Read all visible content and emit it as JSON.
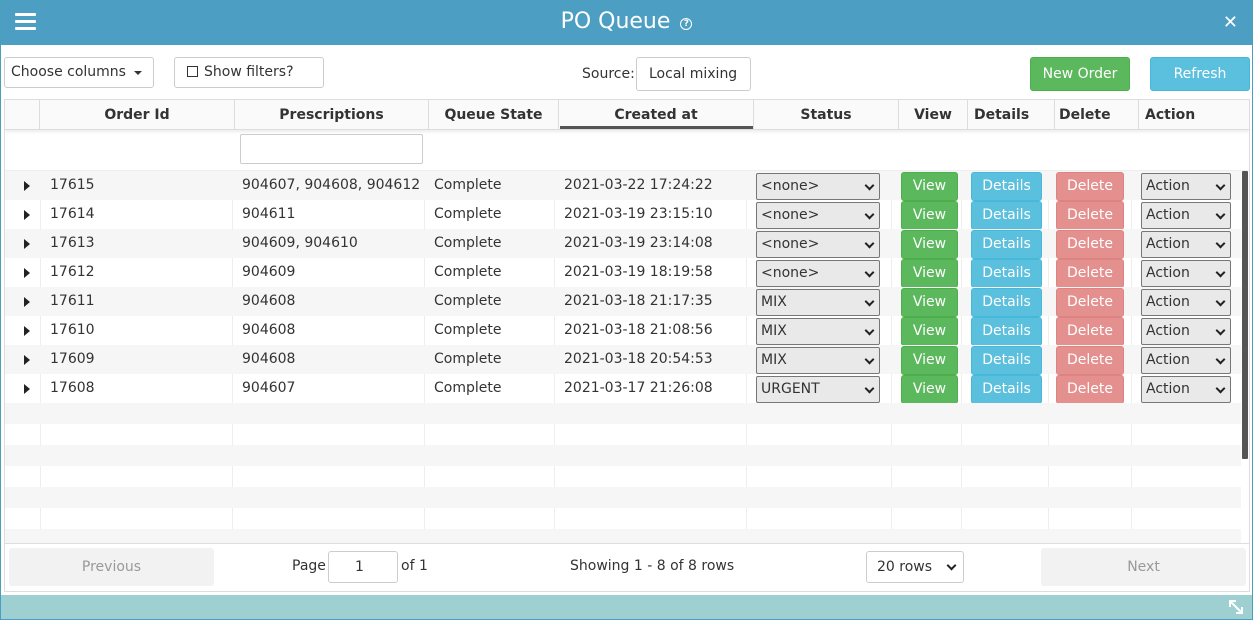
{
  "window": {
    "title": "PO Queue",
    "help_glyph": "?",
    "close_glyph": "✕"
  },
  "toolbar": {
    "choose_columns": "Choose columns",
    "show_filters": "Show filters?",
    "source_label": "Source:",
    "source_value": "Local mixing",
    "new_order": "New Order",
    "refresh": "Refresh"
  },
  "columns": [
    "",
    "Order Id",
    "Prescriptions",
    "Queue State",
    "Created at",
    "Status",
    "View",
    "Details",
    "Delete",
    "Action"
  ],
  "rows": [
    {
      "order_id": "17615",
      "prescriptions": "904607, 904608, 904612",
      "queue_state": "Complete",
      "created_at": "2021-03-22 17:24:22",
      "status": "<none>"
    },
    {
      "order_id": "17614",
      "prescriptions": "904611",
      "queue_state": "Complete",
      "created_at": "2021-03-19 23:15:10",
      "status": "<none>"
    },
    {
      "order_id": "17613",
      "prescriptions": "904609, 904610",
      "queue_state": "Complete",
      "created_at": "2021-03-19 23:14:08",
      "status": "<none>"
    },
    {
      "order_id": "17612",
      "prescriptions": "904609",
      "queue_state": "Complete",
      "created_at": "2021-03-19 18:19:58",
      "status": "<none>"
    },
    {
      "order_id": "17611",
      "prescriptions": "904608",
      "queue_state": "Complete",
      "created_at": "2021-03-18 21:17:35",
      "status": "MIX"
    },
    {
      "order_id": "17610",
      "prescriptions": "904608",
      "queue_state": "Complete",
      "created_at": "2021-03-18 21:08:56",
      "status": "MIX"
    },
    {
      "order_id": "17609",
      "prescriptions": "904608",
      "queue_state": "Complete",
      "created_at": "2021-03-18 20:54:53",
      "status": "MIX"
    },
    {
      "order_id": "17608",
      "prescriptions": "904607",
      "queue_state": "Complete",
      "created_at": "2021-03-17 21:26:08",
      "status": "URGENT"
    }
  ],
  "row_buttons": {
    "view": "View",
    "details": "Details",
    "delete": "Delete",
    "action": "Action"
  },
  "pager": {
    "previous": "Previous",
    "page_label": "Page",
    "page_value": "1",
    "of_label": "of 1",
    "showing": "Showing 1 - 8 of 8 rows",
    "rows_option": "20 rows",
    "next": "Next"
  },
  "colors": {
    "header": "#4c9fc3",
    "green": "#5cb85c",
    "blue": "#5bc0de",
    "delete": "#e4908f",
    "footer": "#9fd0d1"
  }
}
